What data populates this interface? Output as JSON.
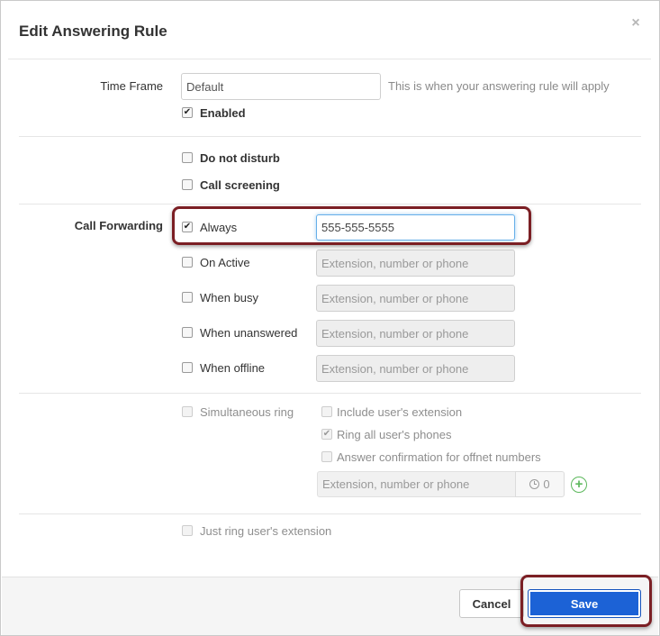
{
  "dialog": {
    "title": "Edit Answering Rule",
    "close_symbol": "×"
  },
  "time_frame": {
    "label": "Time Frame",
    "value": "Default",
    "help": "This is when your answering rule will apply",
    "enabled_label": "Enabled"
  },
  "options": {
    "do_not_disturb": "Do not disturb",
    "call_screening": "Call screening"
  },
  "call_forwarding": {
    "label": "Call Forwarding",
    "always_label": "Always",
    "always_value": "555-555-5555",
    "placeholder": "Extension, number or phone",
    "on_active_label": "On Active",
    "when_busy_label": "When busy",
    "when_unanswered_label": "When unanswered",
    "when_offline_label": "When offline"
  },
  "simultaneous": {
    "label": "Simultaneous ring",
    "include_ext_label": "Include user's extension",
    "ring_all_label": "Ring all user's phones",
    "answer_confirm_label": "Answer confirmation for offnet numbers",
    "placeholder": "Extension, number or phone",
    "timer_value": "0"
  },
  "just_ring": {
    "label": "Just ring user's extension"
  },
  "footer": {
    "cancel_label": "Cancel",
    "save_label": "Save"
  },
  "colors": {
    "save_button": "#1c62d6",
    "highlight": "#7b1f24",
    "add_icon": "#5cb85c"
  },
  "icons": {
    "check": "✔",
    "close": "close-icon",
    "clock": "clock-icon",
    "add": "plus-circle-icon"
  }
}
